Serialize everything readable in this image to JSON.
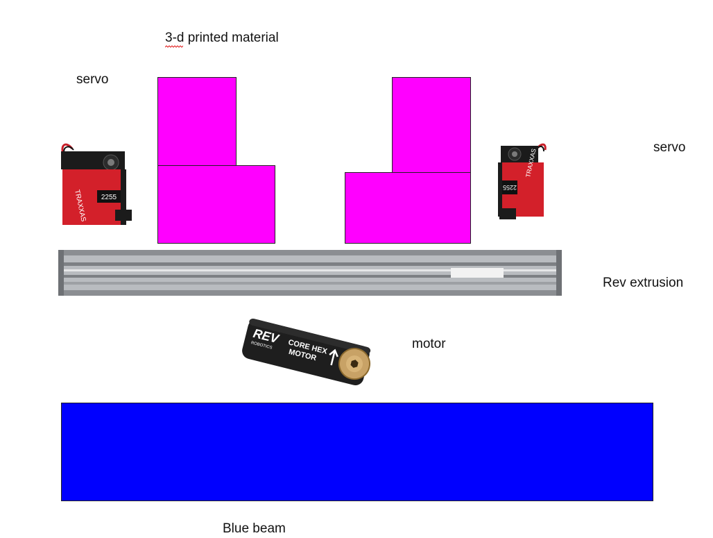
{
  "labels": {
    "printed_material": "3-d printed material",
    "servo_left": "servo",
    "servo_right": "servo",
    "rev_extrusion": "Rev extrusion",
    "motor": "motor",
    "blue_beam": "Blue beam"
  },
  "servo_photo": {
    "brand_text": "TRAXXAS",
    "model_text": "2255"
  },
  "motor_photo": {
    "brand_text": "REV",
    "sub_brand_text": "ROBOTICS",
    "product_line1": "CORE HEX",
    "product_line2": "MOTOR"
  },
  "colors": {
    "printed_material": "#ff00ff",
    "blue_beam": "#0000ff",
    "servo_red": "#d3202a",
    "servo_black": "#1b1b1b",
    "extrusion": "#a7aaae",
    "motor_body": "#1e1e1e",
    "motor_gear": "#c8a266"
  }
}
